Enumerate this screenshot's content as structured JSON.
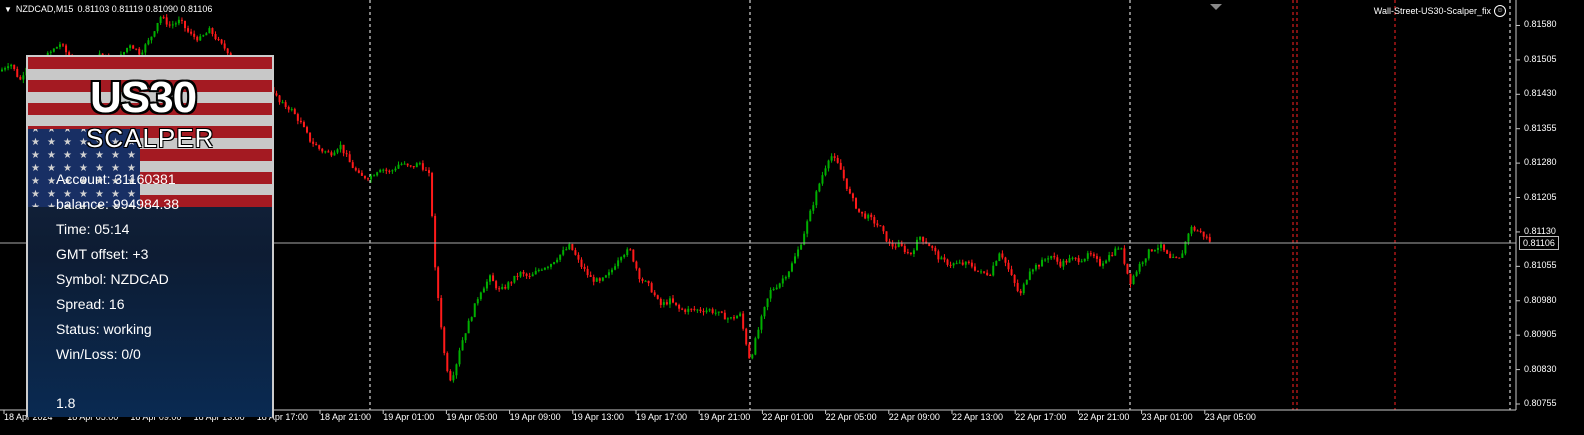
{
  "header": {
    "symbol": "NZDCAD,M15",
    "ohlc": "0.81103 0.81119 0.81090 0.81106"
  },
  "expert": {
    "name": "Wall-Street-US30-Scalper_fix",
    "icon": "smiley-icon"
  },
  "price_axis": {
    "labels": [
      "0.81580",
      "0.81505",
      "0.81430",
      "0.81355",
      "0.81280",
      "0.81205",
      "0.81130",
      "0.81055",
      "0.80980",
      "0.80905",
      "0.80830",
      "0.80755"
    ],
    "current": "0.81106"
  },
  "time_axis": {
    "labels": [
      "18 Apr 2024",
      "18 Apr 05:00",
      "18 Apr 09:00",
      "18 Apr 13:00",
      "18 Apr 17:00",
      "18 Apr 21:00",
      "19 Apr 01:00",
      "19 Apr 05:00",
      "19 Apr 09:00",
      "19 Apr 13:00",
      "19 Apr 17:00",
      "19 Apr 21:00",
      "22 Apr 01:00",
      "22 Apr 05:00",
      "22 Apr 09:00",
      "22 Apr 13:00",
      "22 Apr 17:00",
      "22 Apr 21:00",
      "23 Apr 01:00",
      "23 Apr 05:00"
    ]
  },
  "panel": {
    "logo_main": "US30",
    "logo_sub": "SCALPER",
    "lines": {
      "account": "Account: 31160381",
      "balance": "balance: 994984.38",
      "time": "Time: 05:14",
      "gmt": "GMT offset: +3",
      "symbol": "Symbol: NZDCAD",
      "spread": "Spread: 16",
      "status": "Status: working",
      "winloss": "Win/Loss: 0/0"
    },
    "version": "1.8"
  },
  "colors": {
    "bull": "#00b000",
    "bear": "#ff1a1a",
    "background": "#000000",
    "separator": "#ffffff",
    "future": "#ff2222"
  },
  "chart_data": {
    "type": "candlestick",
    "title": "NZDCAD,M15",
    "ylim": [
      0.80755,
      0.81605
    ],
    "current_price": 0.81106,
    "path": [
      [
        0,
        0.8148
      ],
      [
        10,
        0.815
      ],
      [
        20,
        0.8146
      ],
      [
        30,
        0.8151
      ],
      [
        40,
        0.815
      ],
      [
        50,
        0.8152
      ],
      [
        60,
        0.8154
      ],
      [
        70,
        0.8151
      ],
      [
        80,
        0.8149
      ],
      [
        90,
        0.815
      ],
      [
        100,
        0.8152
      ],
      [
        110,
        0.815
      ],
      [
        120,
        0.8151
      ],
      [
        130,
        0.8154
      ],
      [
        140,
        0.8152
      ],
      [
        150,
        0.8155
      ],
      [
        160,
        0.816
      ],
      [
        170,
        0.8158
      ],
      [
        180,
        0.8159
      ],
      [
        190,
        0.8156
      ],
      [
        200,
        0.8155
      ],
      [
        210,
        0.8157
      ],
      [
        220,
        0.8154
      ],
      [
        230,
        0.8152
      ],
      [
        240,
        0.815
      ],
      [
        250,
        0.8147
      ],
      [
        260,
        0.8146
      ],
      [
        270,
        0.8145
      ],
      [
        280,
        0.8141
      ],
      [
        290,
        0.814
      ],
      [
        300,
        0.8137
      ],
      [
        310,
        0.8133
      ],
      [
        320,
        0.8131
      ],
      [
        330,
        0.813
      ],
      [
        340,
        0.8132
      ],
      [
        350,
        0.8128
      ],
      [
        360,
        0.8125
      ],
      [
        370,
        0.8125
      ],
      [
        380,
        0.8127
      ],
      [
        390,
        0.8126
      ],
      [
        400,
        0.8128
      ],
      [
        410,
        0.8127
      ],
      [
        420,
        0.8128
      ],
      [
        430,
        0.8125
      ],
      [
        435,
        0.8105
      ],
      [
        440,
        0.8095
      ],
      [
        445,
        0.8085
      ],
      [
        450,
        0.8081
      ],
      [
        455,
        0.8083
      ],
      [
        460,
        0.8088
      ],
      [
        470,
        0.8094
      ],
      [
        480,
        0.81
      ],
      [
        490,
        0.8103
      ],
      [
        500,
        0.81
      ],
      [
        510,
        0.8102
      ],
      [
        520,
        0.8104
      ],
      [
        530,
        0.8103
      ],
      [
        540,
        0.8105
      ],
      [
        550,
        0.8106
      ],
      [
        560,
        0.8108
      ],
      [
        570,
        0.811
      ],
      [
        580,
        0.8106
      ],
      [
        590,
        0.8103
      ],
      [
        600,
        0.8102
      ],
      [
        610,
        0.8104
      ],
      [
        620,
        0.8108
      ],
      [
        630,
        0.8109
      ],
      [
        640,
        0.8103
      ],
      [
        650,
        0.8101
      ],
      [
        660,
        0.8097
      ],
      [
        670,
        0.8098
      ],
      [
        680,
        0.8096
      ],
      [
        690,
        0.8096
      ],
      [
        700,
        0.8096
      ],
      [
        710,
        0.8096
      ],
      [
        720,
        0.8095
      ],
      [
        730,
        0.8094
      ],
      [
        740,
        0.8095
      ],
      [
        750,
        0.8085
      ],
      [
        760,
        0.8093
      ],
      [
        770,
        0.81
      ],
      [
        780,
        0.8102
      ],
      [
        790,
        0.8105
      ],
      [
        800,
        0.811
      ],
      [
        810,
        0.8117
      ],
      [
        820,
        0.8124
      ],
      [
        830,
        0.813
      ],
      [
        840,
        0.8127
      ],
      [
        850,
        0.8121
      ],
      [
        860,
        0.8117
      ],
      [
        870,
        0.8116
      ],
      [
        880,
        0.8114
      ],
      [
        890,
        0.811
      ],
      [
        900,
        0.811
      ],
      [
        910,
        0.8108
      ],
      [
        920,
        0.8112
      ],
      [
        930,
        0.811
      ],
      [
        940,
        0.8107
      ],
      [
        950,
        0.8106
      ],
      [
        960,
        0.8106
      ],
      [
        970,
        0.8106
      ],
      [
        980,
        0.8104
      ],
      [
        990,
        0.8104
      ],
      [
        1000,
        0.8109
      ],
      [
        1010,
        0.8104
      ],
      [
        1020,
        0.8099
      ],
      [
        1030,
        0.8105
      ],
      [
        1040,
        0.8106
      ],
      [
        1050,
        0.8108
      ],
      [
        1060,
        0.8106
      ],
      [
        1070,
        0.8107
      ],
      [
        1080,
        0.8107
      ],
      [
        1090,
        0.8108
      ],
      [
        1100,
        0.8106
      ],
      [
        1110,
        0.8108
      ],
      [
        1120,
        0.811
      ],
      [
        1130,
        0.8102
      ],
      [
        1140,
        0.8106
      ],
      [
        1150,
        0.8109
      ],
      [
        1160,
        0.811
      ],
      [
        1170,
        0.8107
      ],
      [
        1180,
        0.8107
      ],
      [
        1190,
        0.8114
      ],
      [
        1200,
        0.8113
      ],
      [
        1210,
        0.8111
      ]
    ],
    "day_separators": [
      "18 Apr 21:00",
      "19 Apr 21:00",
      "22 Apr 21:00",
      "23 Apr 05:00"
    ]
  }
}
